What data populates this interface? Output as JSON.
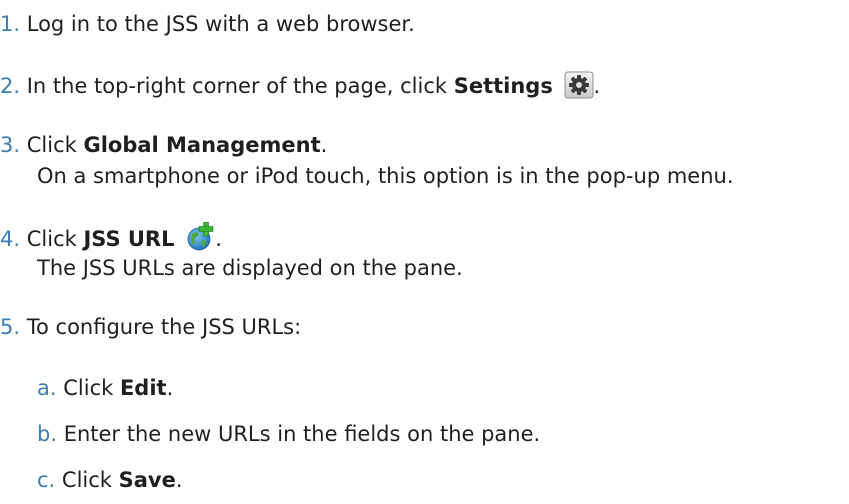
{
  "steps": [
    {
      "num": "1.",
      "text": "Log in to the JSS with a web browser."
    },
    {
      "num": "2.",
      "pre": "In the top-right corner of the page, click ",
      "bold": "Settings",
      "icon": "gear-icon",
      "post": "."
    },
    {
      "num": "3.",
      "pre": "Click ",
      "bold": "Global Management",
      "post": ".",
      "note": "On a smartphone or iPod touch, this option is in the pop-up menu."
    },
    {
      "num": "4.",
      "pre": "Click ",
      "bold": "JSS URL",
      "icon": "globe-plus-icon",
      "post": ".",
      "note": "The JSS URLs are displayed on the pane."
    },
    {
      "num": "5.",
      "text": "To configure the JSS URLs:"
    }
  ],
  "substeps": [
    {
      "num": "a.",
      "pre": "Click ",
      "bold": "Edit",
      "post": "."
    },
    {
      "num": "b.",
      "text": "Enter the new URLs in the fields on the pane."
    },
    {
      "num": "c.",
      "pre": "Click ",
      "bold": "Save",
      "post": "."
    }
  ],
  "colors": {
    "number": "#3d7fb3",
    "text": "#1f1f1f"
  }
}
